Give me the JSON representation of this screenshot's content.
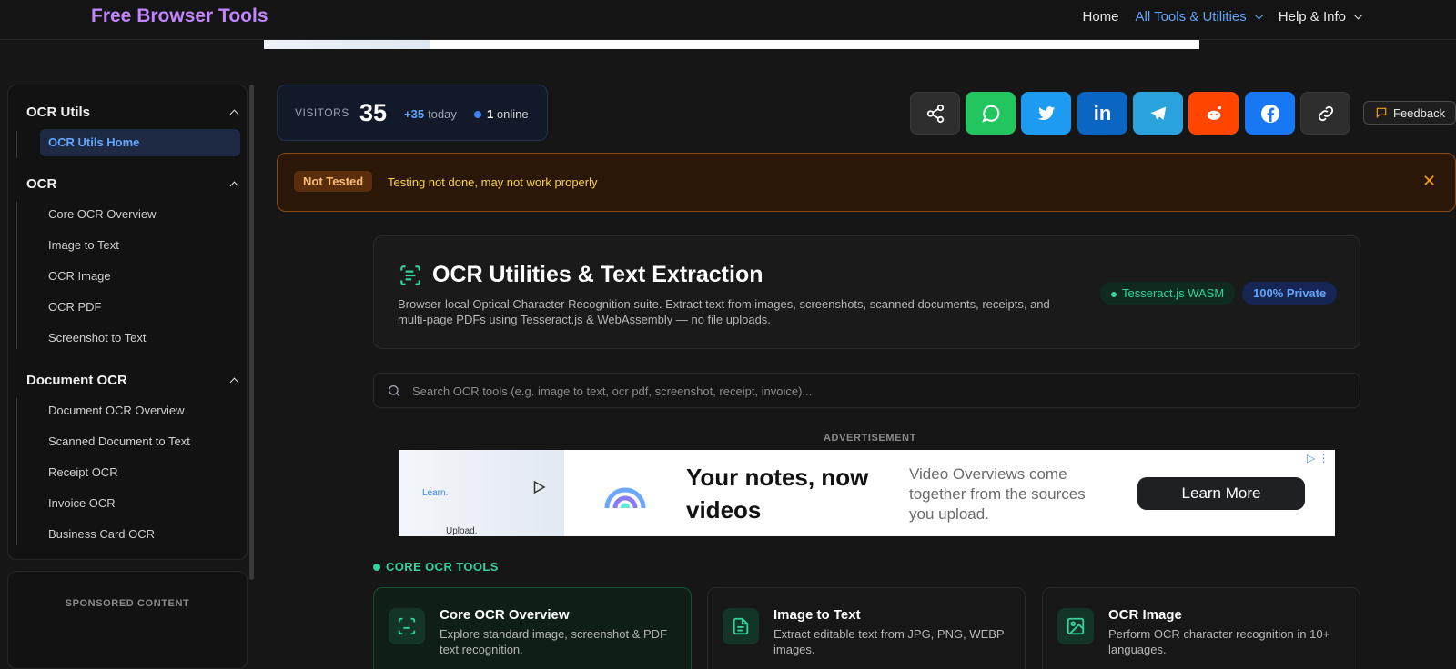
{
  "nav": {
    "brand": "Free Browser Tools",
    "links": [
      {
        "label": "Home"
      },
      {
        "label": "All Tools & Utilities"
      },
      {
        "label": "Help & Info"
      }
    ]
  },
  "sidebar": {
    "groups": [
      {
        "title": "OCR Utils",
        "items": [
          "OCR Utils Home"
        ]
      },
      {
        "title": "OCR",
        "items": [
          "Core OCR Overview",
          "Image to Text",
          "OCR Image",
          "OCR PDF",
          "Screenshot to Text"
        ]
      },
      {
        "title": "Document OCR",
        "items": [
          "Document OCR Overview",
          "Scanned Document to Text",
          "Receipt OCR",
          "Invoice OCR",
          "Business Card OCR"
        ]
      }
    ],
    "sponsored_label": "SPONSORED CONTENT"
  },
  "visitors": {
    "label": "VISITORS",
    "count": "35",
    "today_delta": "+35",
    "today_label": "today",
    "online_count": "1",
    "online_label": "online"
  },
  "share": {
    "buttons": [
      "share-icon",
      "whatsapp-icon",
      "twitter-icon",
      "linkedin-icon",
      "telegram-icon",
      "reddit-icon",
      "facebook-icon",
      "link-icon"
    ],
    "feedback_label": "Feedback"
  },
  "warning": {
    "badge": "Not Tested",
    "text": "Testing not done, may not work properly"
  },
  "hero": {
    "title": "OCR Utilities & Text Extraction",
    "description": "Browser-local Optical Character Recognition suite. Extract text from images, screenshots, scanned documents, receipts, and multi-page PDFs using Tesseract.js & WebAssembly — no file uploads.",
    "badges": [
      "Tesseract.js WASM",
      "100% Private"
    ]
  },
  "search": {
    "placeholder": "Search OCR tools (e.g. image to text, ocr pdf, screenshot, receipt, invoice)..."
  },
  "ad": {
    "label": "ADVERTISEMENT",
    "left_text": "Upload. Watch.",
    "left_link": "Learn.",
    "headline": "Your notes, now videos",
    "subtext": "Video Overviews come together from the sources you upload.",
    "cta": "Learn More"
  },
  "section": {
    "title": "CORE OCR TOOLS",
    "cards": [
      {
        "title": "Core OCR Overview",
        "desc": "Explore standard image, screenshot & PDF text recognition."
      },
      {
        "title": "Image to Text",
        "desc": "Extract editable text from JPG, PNG, WEBP images."
      },
      {
        "title": "OCR Image",
        "desc": "Perform OCR character recognition in 10+ languages."
      }
    ]
  },
  "colors": {
    "accent_purple": "#c084fc",
    "accent_blue": "#60a5fa",
    "accent_green": "#34d399",
    "warning_amber": "#fcd34d"
  }
}
